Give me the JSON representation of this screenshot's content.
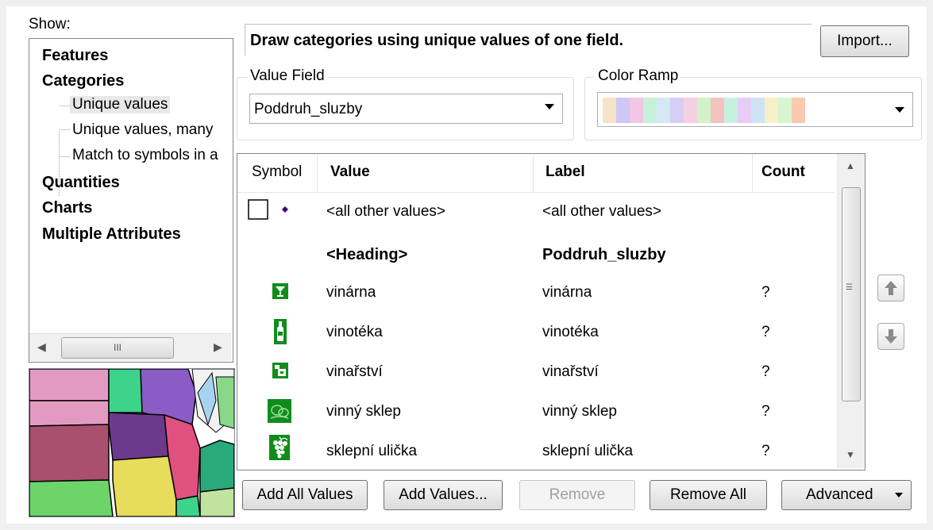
{
  "show": {
    "label": "Show:",
    "items": [
      {
        "label": "Features",
        "type": "category"
      },
      {
        "label": "Categories",
        "type": "category"
      },
      {
        "label": "Unique values",
        "type": "sub",
        "selected": true
      },
      {
        "label": "Unique values, many",
        "type": "sub"
      },
      {
        "label": "Match to symbols in a",
        "type": "sub"
      },
      {
        "label": "Quantities",
        "type": "category"
      },
      {
        "label": "Charts",
        "type": "category"
      },
      {
        "label": "Multiple Attributes",
        "type": "category"
      }
    ],
    "scroll_grip": "III"
  },
  "description": "Draw categories using unique values of one field.",
  "import_button": "Import...",
  "value_field": {
    "legend": "Value Field",
    "value": "Poddruh_sluzby"
  },
  "color_ramp": {
    "legend": "Color Ramp",
    "colors": [
      "#f7e3c5",
      "#cfc7f5",
      "#f2c6e4",
      "#c7f0d8",
      "#d5e8f5",
      "#d6cff5",
      "#f5d0e3",
      "#d2f2c8",
      "#f5c2c2",
      "#c8f0e0",
      "#e5cdf5",
      "#cfe3f5",
      "#f5f0c8",
      "#d7f5d0",
      "#f9c9b0"
    ]
  },
  "table": {
    "headers": {
      "symbol": "Symbol",
      "value": "Value",
      "label": "Label",
      "count": "Count"
    },
    "rows": [
      {
        "symbol": "all-other-symbol",
        "value": "<all other values>",
        "label": "<all other values>",
        "count": "",
        "heading": false
      },
      {
        "symbol": "",
        "value": "<Heading>",
        "label": "Poddruh_sluzby",
        "count": "",
        "heading": true
      },
      {
        "symbol": "cocktail-icon",
        "value": "vinárna",
        "label": "vinárna",
        "count": "?",
        "heading": false
      },
      {
        "symbol": "wine-bottle-icon",
        "value": "vinotéka",
        "label": "vinotéka",
        "count": "?",
        "heading": false
      },
      {
        "symbol": "winery-icon",
        "value": "vinařství",
        "label": "vinařství",
        "count": "?",
        "heading": false
      },
      {
        "symbol": "wine-cellar-icon",
        "value": "vinný sklep",
        "label": "vinný sklep",
        "count": "?",
        "heading": false
      },
      {
        "symbol": "grape-cluster-icon",
        "value": "sklepní ulička",
        "label": "sklepní ulička",
        "count": "?",
        "heading": false
      }
    ]
  },
  "buttons": {
    "add_all_values": "Add All Values",
    "add_values": "Add Values...",
    "remove": "Remove",
    "remove_all": "Remove All",
    "advanced": "Advanced"
  },
  "colors": {
    "symbol_green": "#118c1c",
    "point_purple": "#3d007a"
  }
}
